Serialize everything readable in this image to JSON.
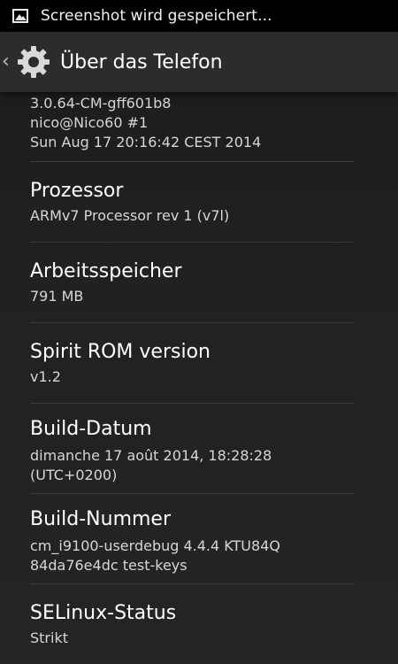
{
  "status_bar": {
    "notification_icon": "image-icon",
    "text": "Screenshot wird gespeichert..."
  },
  "action_bar": {
    "up_icon": "chevron-left-icon",
    "app_icon": "gear-icon",
    "title": "Über das Telefon"
  },
  "rows": {
    "kernel": {
      "lines": [
        "3.0.64-CM-gff601b8",
        "nico@Nico60 #1",
        "Sun Aug 17 20:16:42 CEST 2014"
      ]
    },
    "processor": {
      "title": "Prozessor",
      "value": "ARMv7 Processor rev 1 (v7l)"
    },
    "memory": {
      "title": "Arbeitsspeicher",
      "value": "791 MB"
    },
    "rom_version": {
      "title": "Spirit ROM version",
      "value": "v1.2"
    },
    "build_date": {
      "title": "Build-Datum",
      "lines": [
        "dimanche 17 août 2014, 18:28:28",
        "(UTC+0200)"
      ]
    },
    "build_number": {
      "title": "Build-Nummer",
      "lines": [
        "cm_i9100-userdebug 4.4.4 KTU84Q",
        "84da76e4dc test-keys"
      ]
    },
    "selinux": {
      "title": "SELinux-Status",
      "value": "Strikt"
    }
  },
  "colors": {
    "status_bar_bg": "#000000",
    "action_bar_bg": "#2b2c2e",
    "background": "#202123",
    "divider": "#3a3b3d",
    "primary_text": "#ffffff",
    "secondary_text": "#d6d6d6"
  }
}
